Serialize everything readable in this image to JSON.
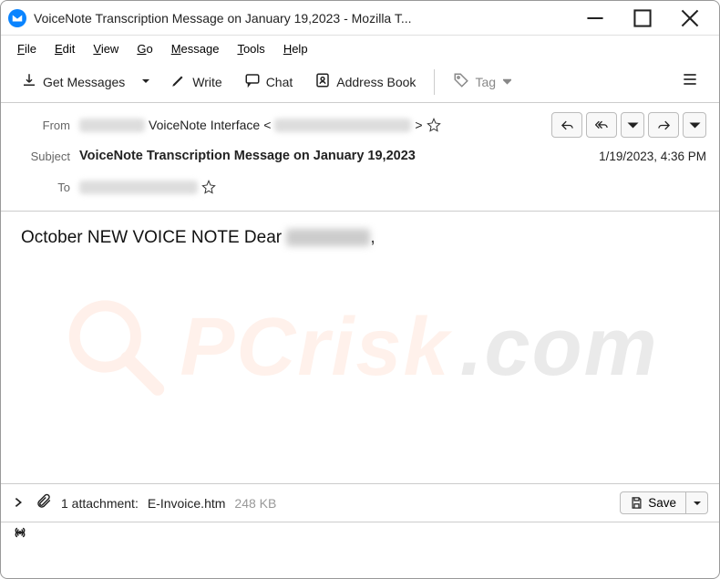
{
  "window": {
    "title": "VoiceNote Transcription Message on January 19,2023 - Mozilla T..."
  },
  "menu": {
    "items": [
      "File",
      "Edit",
      "View",
      "Go",
      "Message",
      "Tools",
      "Help"
    ]
  },
  "toolbar": {
    "get_messages": "Get Messages",
    "write": "Write",
    "chat": "Chat",
    "address_book": "Address Book",
    "tag": "Tag"
  },
  "header": {
    "from_label": "From",
    "from_name": "VoiceNote Interface",
    "from_prefix_redacted": "[redacted]",
    "from_email_redacted": "[redacted]",
    "subject_label": "Subject",
    "subject": "VoiceNote Transcription Message on January 19,2023",
    "date": "1/19/2023, 4:36 PM",
    "to_label": "To",
    "to_redacted": "[redacted]"
  },
  "body": {
    "text_before": "October NEW VOICE NOTE Dear ",
    "name_redacted": "[redacted]",
    "text_after": ","
  },
  "attachment": {
    "count_text": "1 attachment:",
    "filename": "E-Invoice.htm",
    "size": "248 KB",
    "save": "Save"
  },
  "watermark": {
    "text": "PCrisk",
    "dot": ".com"
  }
}
